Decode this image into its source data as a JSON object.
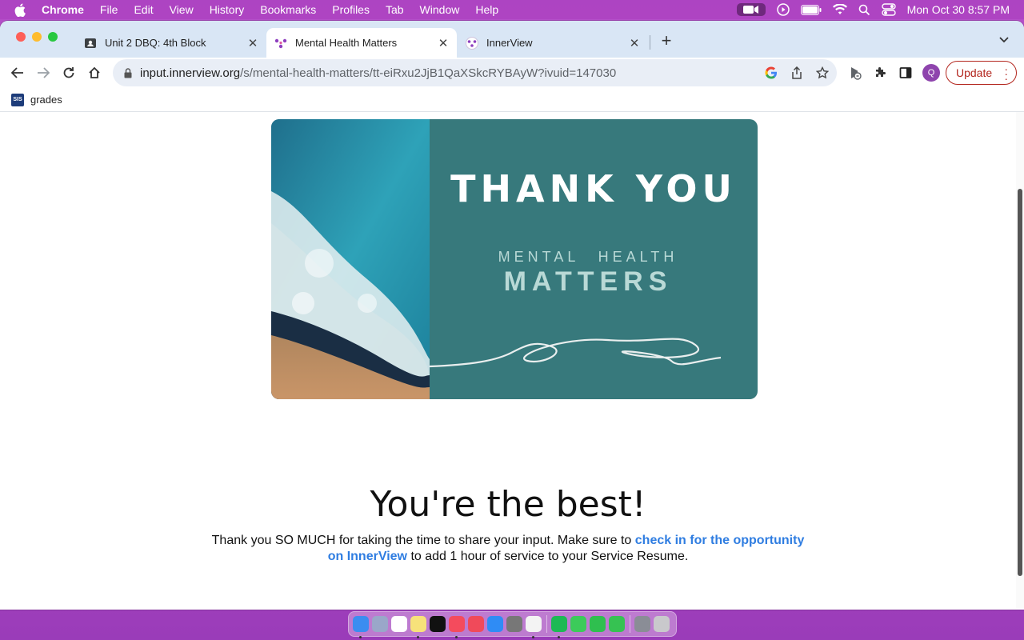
{
  "menubar": {
    "app_name": "Chrome",
    "items": [
      "File",
      "Edit",
      "View",
      "History",
      "Bookmarks",
      "Profiles",
      "Tab",
      "Window",
      "Help"
    ],
    "clock": "Mon Oct 30  8:57 PM"
  },
  "tabs": [
    {
      "title": "Unit 2 DBQ: 4th Block",
      "icon": "classroom-icon",
      "active": false
    },
    {
      "title": "Mental Health Matters",
      "icon": "innerview-icon",
      "active": true
    },
    {
      "title": "InnerView",
      "icon": "innerview-icon",
      "active": false
    }
  ],
  "omnibox": {
    "host": "input.innerview.org",
    "path": "/s/mental-health-matters/tt-eiRxu2JjB1QaXSkcRYBAyW?ivuid=147030"
  },
  "profile_initial": "Q",
  "update_label": "Update",
  "bookmarks": [
    {
      "icon_text": "SIS",
      "label": "grades"
    }
  ],
  "hero": {
    "thank_you": "THANK YOU",
    "line1": "MENTAL HEALTH",
    "line2": "MATTERS"
  },
  "content": {
    "headline": "You're the best!",
    "text_before": "Thank you SO MUCH for taking the time to share your input. Make sure to ",
    "link_text": "check in for the opportunity on InnerView",
    "text_after": " to add 1 hour of service to your Service Resume."
  },
  "colors": {
    "accent": "#2f7de1",
    "hero_bg": "#37797c",
    "update": "#b3261e"
  }
}
